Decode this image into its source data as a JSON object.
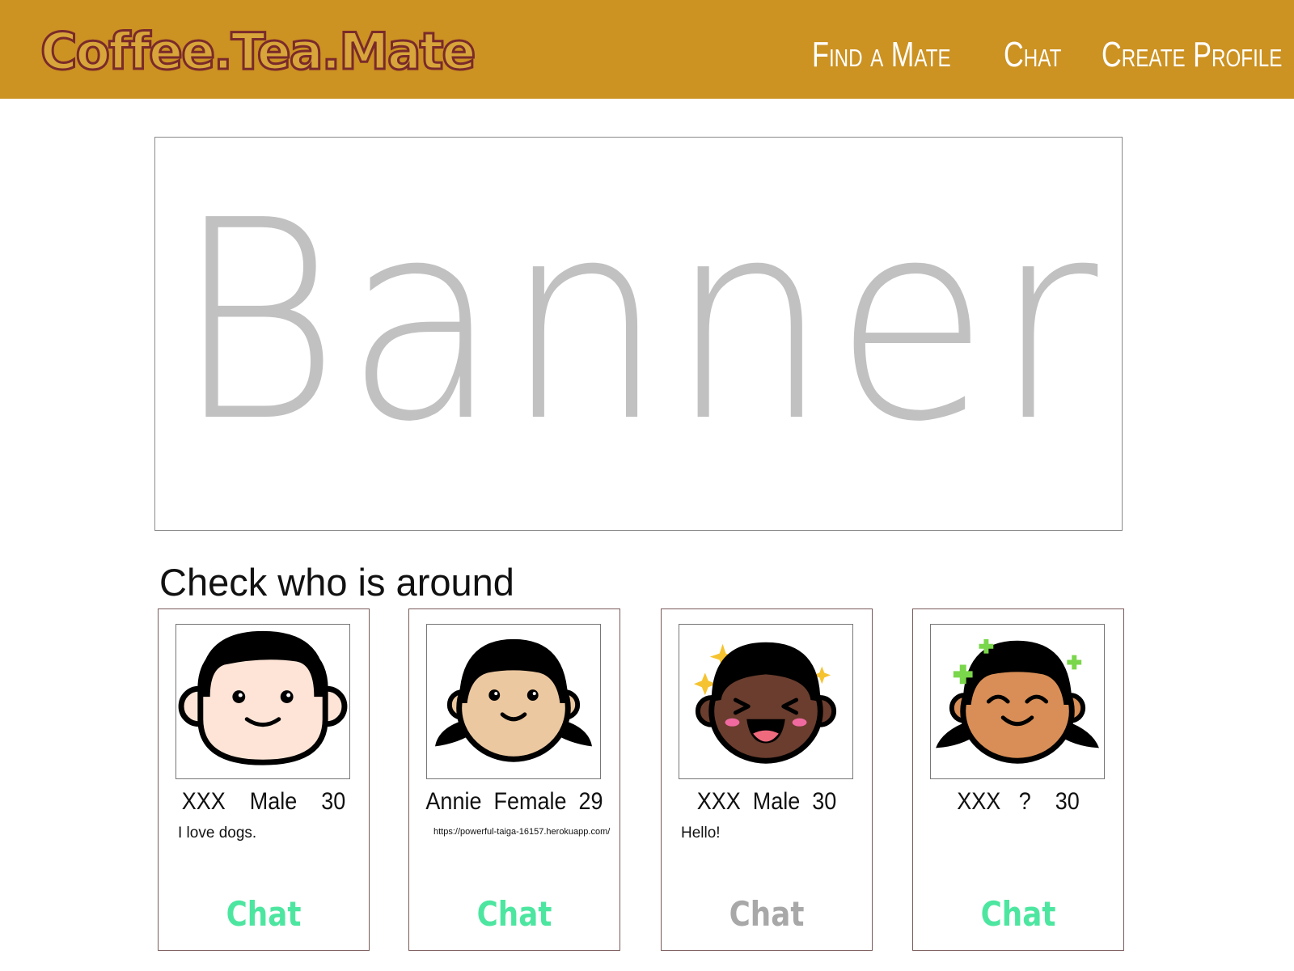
{
  "header": {
    "logo": "Coffee.Tea.Mate",
    "nav": [
      {
        "label": "Find a Mate"
      },
      {
        "label": "Chat"
      },
      {
        "label": "Create Profile"
      }
    ]
  },
  "banner": {
    "text": "Banner"
  },
  "section": {
    "title": "Check who is around"
  },
  "cards": [
    {
      "info": "XXX    Male    30",
      "bio": "I love dogs.",
      "chat_label": "Chat",
      "chat_color": "#4de6a0",
      "avatar": "boy-avatar"
    },
    {
      "info": "Annie  Female  29",
      "bio": "https://powerful-taiga-16157.herokuapp.com/",
      "chat_label": "Chat",
      "chat_color": "#4de6a0",
      "avatar": "girl-avatar"
    },
    {
      "info": "XXX  Male  30",
      "bio": "Hello!",
      "chat_label": "Chat",
      "chat_color": "#a8a8a8",
      "avatar": "laughing-boy-avatar"
    },
    {
      "info": "XXX   ?    30",
      "bio": "",
      "chat_label": "Chat",
      "chat_color": "#4de6a0",
      "avatar": "smiling-girl-avatar"
    }
  ],
  "colors": {
    "header_bg": "#cc9222",
    "logo_fill": "#d8a53a",
    "logo_stroke": "#7a2a2a",
    "banner_text": "#c1c1c1",
    "chat_active": "#4de6a0",
    "chat_inactive": "#a8a8a8"
  }
}
